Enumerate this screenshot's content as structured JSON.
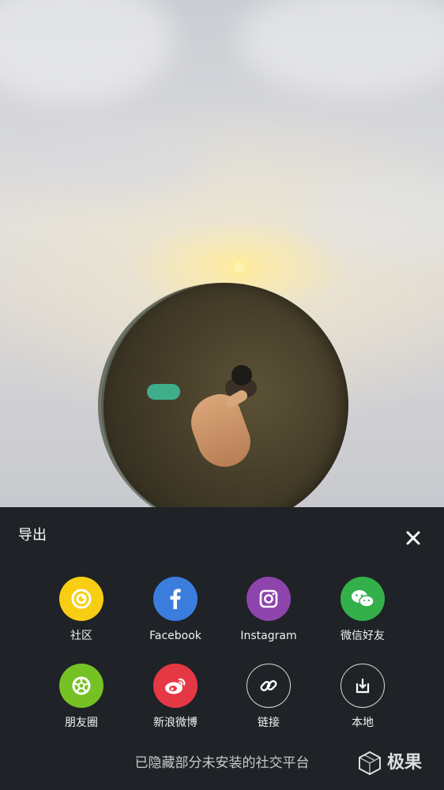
{
  "export_panel": {
    "title": "导出",
    "close_icon": "close-icon",
    "items": [
      {
        "label": "社区",
        "icon": "community-icon",
        "color": "#F7CE12"
      },
      {
        "label": "Facebook",
        "icon": "facebook-icon",
        "color": "#3B7DDD"
      },
      {
        "label": "Instagram",
        "icon": "instagram-icon",
        "color": "#8E44AD"
      },
      {
        "label": "微信好友",
        "icon": "wechat-icon",
        "color": "#34B04A"
      },
      {
        "label": "朋友圈",
        "icon": "moments-icon",
        "color": "#76C225"
      },
      {
        "label": "新浪微博",
        "icon": "weibo-icon",
        "color": "#E63844"
      },
      {
        "label": "链接",
        "icon": "link-icon",
        "color": "#1F2227"
      },
      {
        "label": "本地",
        "icon": "download-icon",
        "color": "#1F2227"
      }
    ],
    "footer_note": "已隐藏部分未安装的社交平台"
  },
  "watermark": {
    "text": "极果"
  },
  "colors": {
    "panel_background": "#1F2227",
    "text": "#FFFFFF"
  }
}
